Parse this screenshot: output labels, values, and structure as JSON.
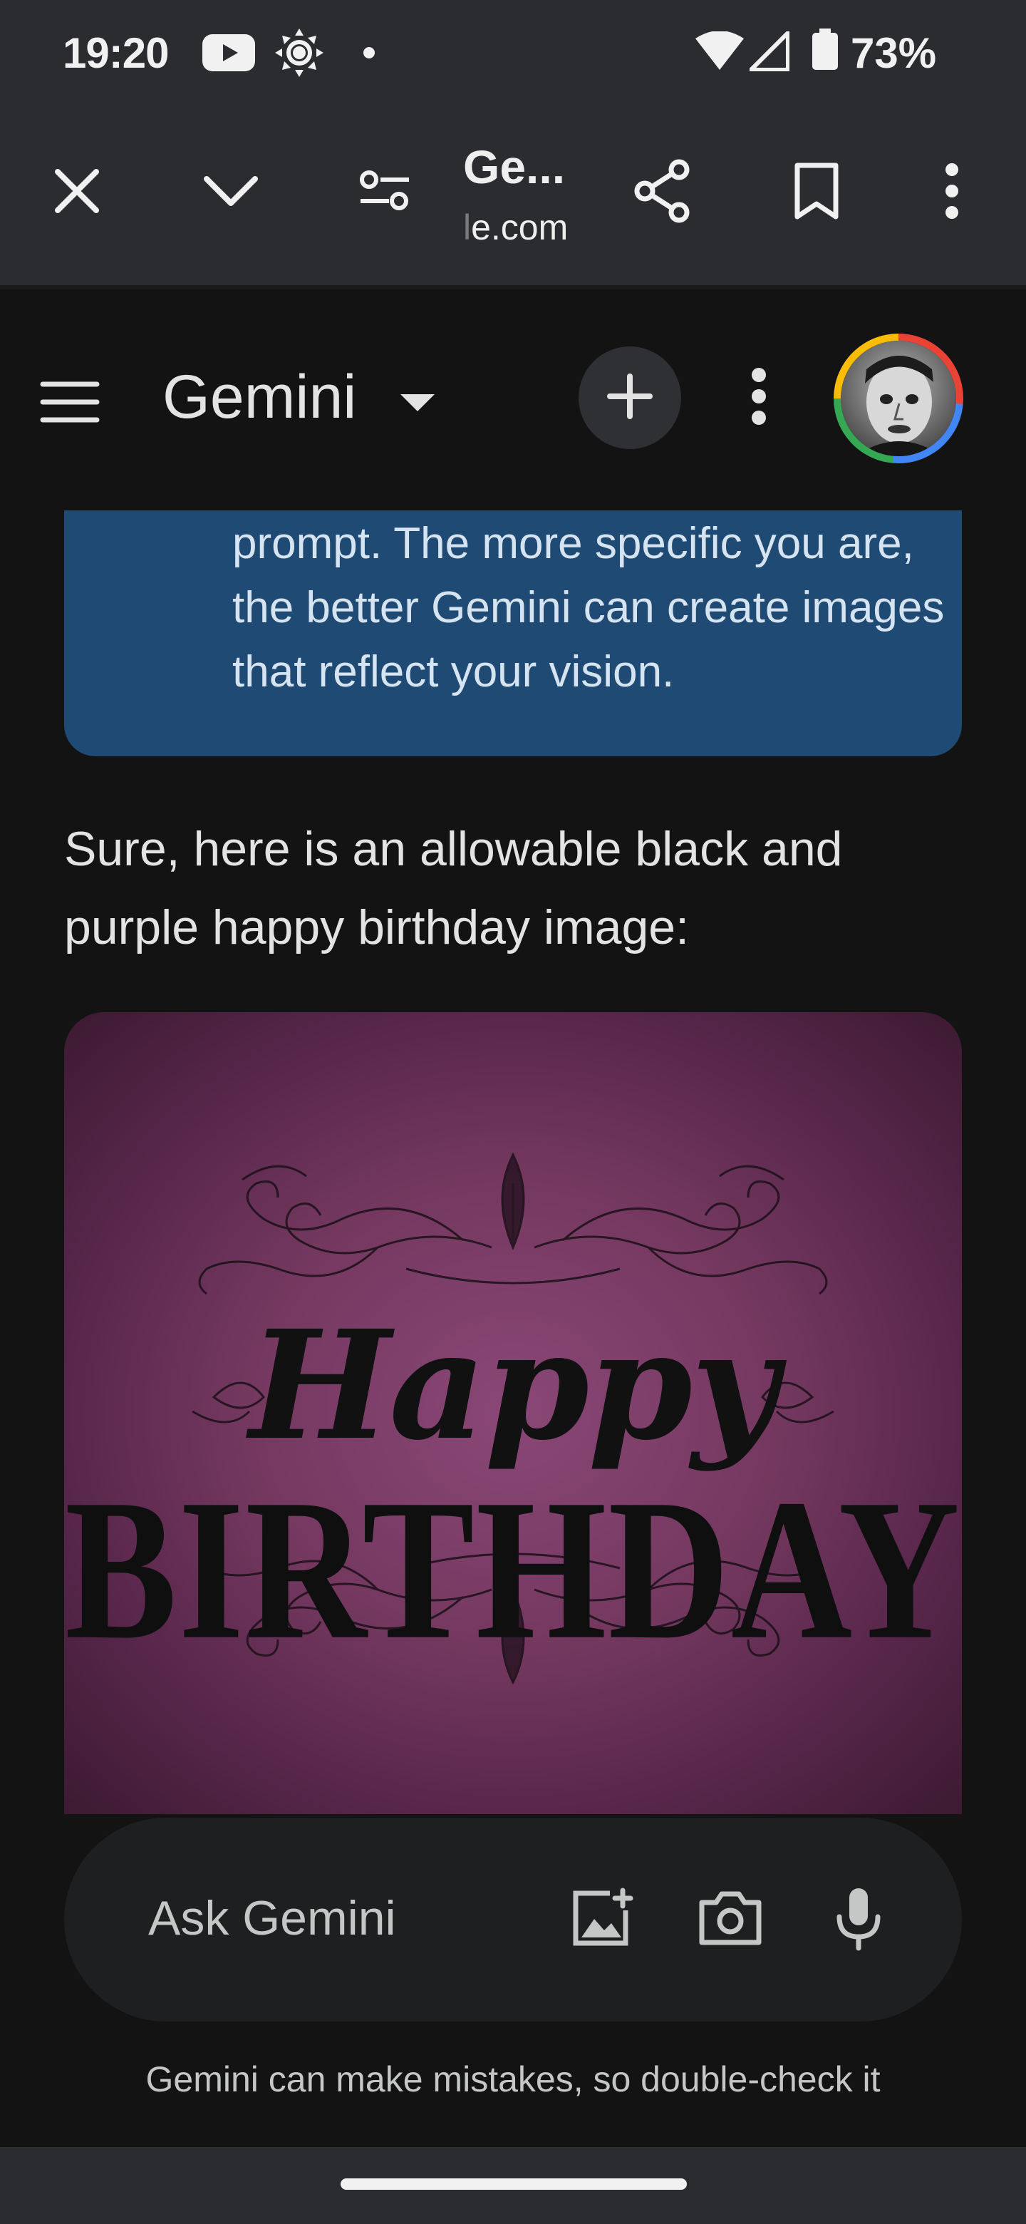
{
  "status_bar": {
    "time": "19:20",
    "battery": "73%",
    "icons": [
      "youtube-icon",
      "brightness-icon",
      "dot-icon",
      "wifi-icon",
      "signal-icon",
      "battery-icon"
    ]
  },
  "browser_toolbar": {
    "page_title": "Ge...",
    "url_faded": "l",
    "url_main": "e.com",
    "icons": [
      "close-icon",
      "chevron-down-icon",
      "site-settings-icon",
      "share-icon",
      "bookmark-icon",
      "more-vert-icon"
    ]
  },
  "gemini_header": {
    "title": "Gemini",
    "icons": [
      "menu-icon",
      "dropdown-caret-icon",
      "new-chat-icon",
      "more-vert-icon",
      "avatar"
    ]
  },
  "conversation": {
    "info_card_text": "prompt. The more specific you are, the better Gemini can create images that reflect your vision.",
    "reply_text": "Sure, here is an allowable black and purple happy birthday image:",
    "image": {
      "line1": "Happy",
      "line2": "BIRTHDAY"
    }
  },
  "input_bar": {
    "placeholder": "Ask Gemini",
    "icons": [
      "add-image-icon",
      "camera-icon",
      "mic-icon"
    ]
  },
  "disclaimer": "Gemini can make mistakes, so double-check it",
  "colors": {
    "background": "#131314",
    "toolbar": "#2b2c30",
    "info_card": "#1f4a73",
    "image_purple": "#74385f"
  }
}
